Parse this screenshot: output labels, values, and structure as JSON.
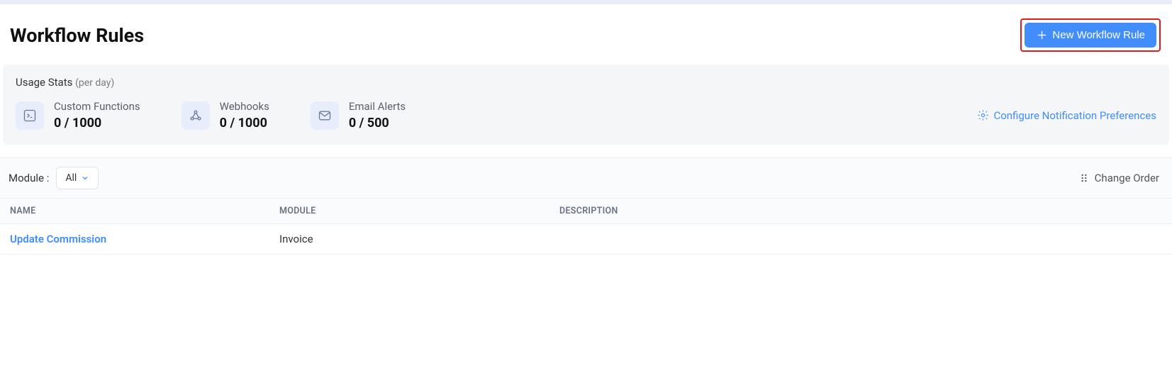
{
  "page": {
    "title": "Workflow Rules",
    "new_button_label": "New Workflow Rule"
  },
  "usage": {
    "title": "Usage Stats",
    "subtitle": "(per day)",
    "stats": [
      {
        "label": "Custom Functions",
        "value": "0 / 1000"
      },
      {
        "label": "Webhooks",
        "value": "0 / 1000"
      },
      {
        "label": "Email Alerts",
        "value": "0 / 500"
      }
    ],
    "configure_label": "Configure Notification Preferences"
  },
  "filter": {
    "module_label": "Module :",
    "module_selected": "All",
    "change_order_label": "Change Order"
  },
  "table": {
    "columns": {
      "name": "NAME",
      "module": "MODULE",
      "description": "DESCRIPTION"
    },
    "rows": [
      {
        "name": "Update Commission",
        "module": "Invoice",
        "description": ""
      }
    ]
  }
}
